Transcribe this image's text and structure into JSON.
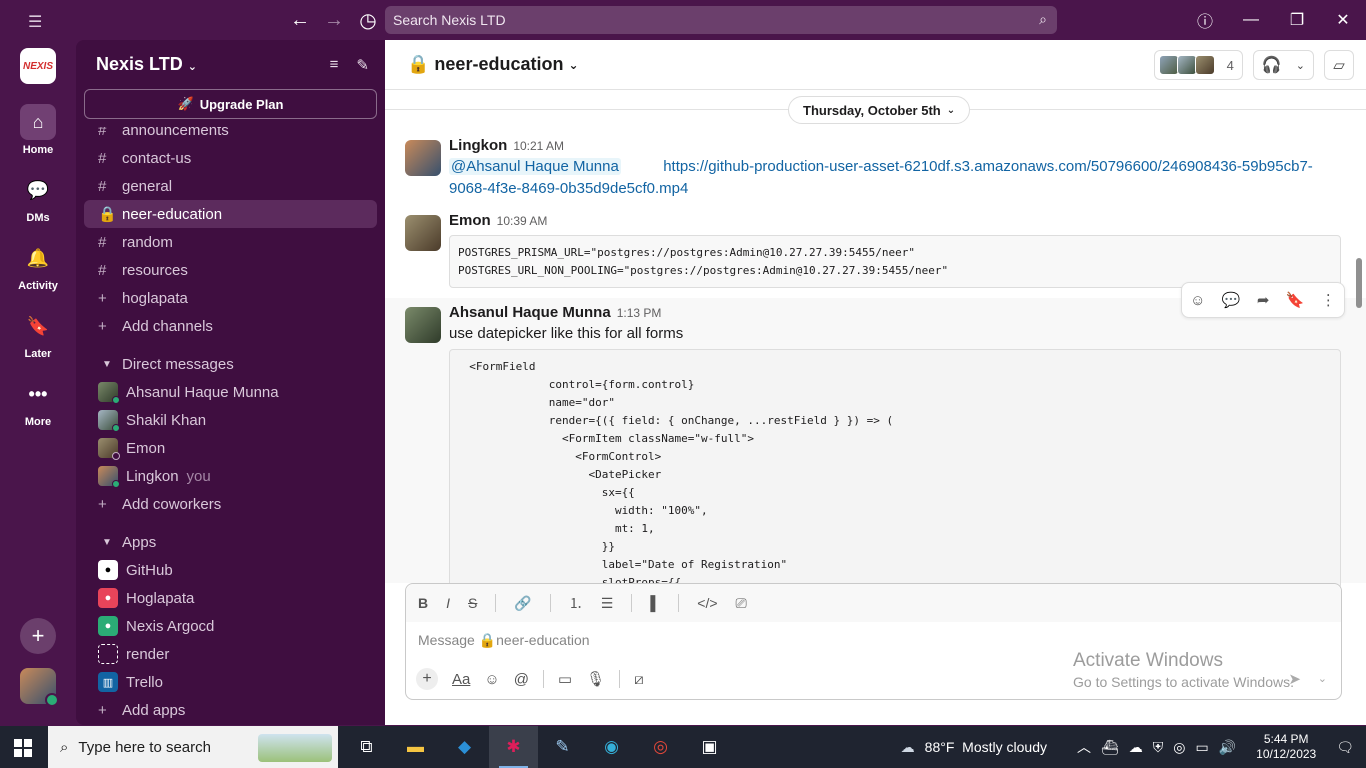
{
  "topbar": {
    "search_placeholder": "Search Nexis LTD"
  },
  "rail": {
    "logo_text": "NEXIS",
    "items": [
      {
        "label": "Home"
      },
      {
        "label": "DMs"
      },
      {
        "label": "Activity"
      },
      {
        "label": "Later"
      },
      {
        "label": "More"
      }
    ]
  },
  "sidebar": {
    "workspace": "Nexis LTD",
    "upgrade_label": "Upgrade Plan",
    "channels": [
      {
        "name": "announcements"
      },
      {
        "name": "contact-us"
      },
      {
        "name": "general"
      },
      {
        "name": "neer-education"
      },
      {
        "name": "random"
      },
      {
        "name": "resources"
      },
      {
        "name": "hoglapata"
      }
    ],
    "add_channels": "Add channels",
    "dm_header": "Direct messages",
    "dms": [
      {
        "name": "Ahsanul Haque Munna"
      },
      {
        "name": "Shakil Khan"
      },
      {
        "name": "Emon"
      },
      {
        "name": "Lingkon",
        "suffix": "you"
      }
    ],
    "add_coworkers": "Add coworkers",
    "apps_header": "Apps",
    "apps": [
      {
        "name": "GitHub",
        "color": "#000000"
      },
      {
        "name": "Hoglapata",
        "color": "#e8445a"
      },
      {
        "name": "Nexis Argocd",
        "color": "#2bac76"
      },
      {
        "name": "render",
        "color": "#ffffff"
      },
      {
        "name": "Trello",
        "color": "#1264a3"
      }
    ],
    "add_apps": "Add apps"
  },
  "channel": {
    "name": "neer-education",
    "member_count": "4",
    "date_divider": "Thursday, October 5th"
  },
  "messages": [
    {
      "author": "Lingkon",
      "time": "10:21 AM",
      "mention": "@Ahsanul Haque Munna",
      "link": "https://github-production-user-asset-6210df.s3.amazonaws.com/50796600/246908436-59b95cb7-9068-4f3e-8469-0b35d9de5cf0.mp4"
    },
    {
      "author": "Emon",
      "time": "10:39 AM",
      "code": "POSTGRES_PRISMA_URL=\"postgres://postgres:Admin@10.27.27.39:5455/neer\"\nPOSTGRES_URL_NON_POOLING=\"postgres://postgres:Admin@10.27.27.39:5455/neer\""
    },
    {
      "author": "Ahsanul Haque Munna",
      "time": "1:13 PM",
      "text": "use datepicker like this for all forms",
      "code": "  <FormField\n              control={form.control}\n              name=\"dor\"\n              render={({ field: { onChange, ...restField } }) => (\n                <FormItem className=\"w-full\">\n                  <FormControl>\n                    <DatePicker\n                      sx={{\n                        width: \"100%\",\n                        mt: 1,\n                      }}\n                      label=\"Date of Registration\"\n                      slotProps={{"
    }
  ],
  "composer": {
    "placeholder": "Message 🔒neer-education"
  },
  "watermark": {
    "line1": "Activate Windows",
    "line2": "Go to Settings to activate Windows."
  },
  "taskbar": {
    "search_placeholder": "Type here to search",
    "weather": "88°F  Mostly cloudy",
    "time": "5:44 PM",
    "date": "10/12/2023"
  }
}
